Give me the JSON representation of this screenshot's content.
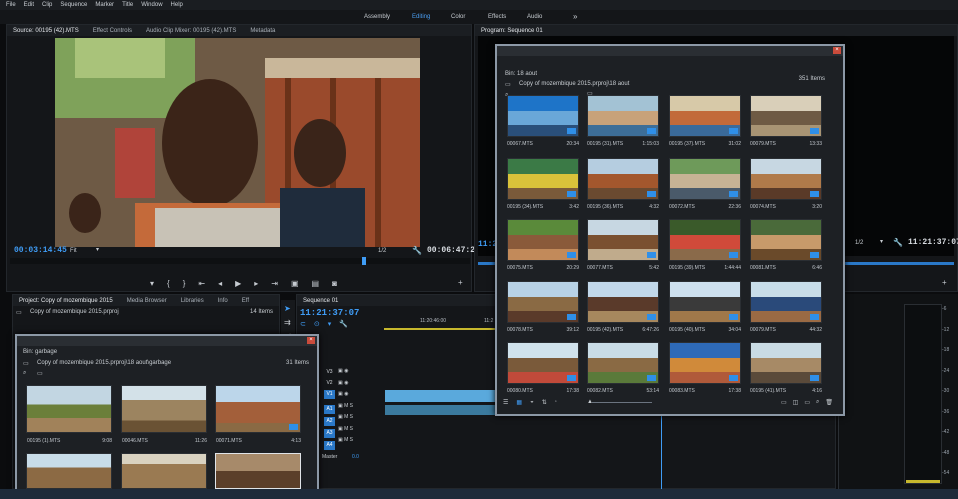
{
  "menu": [
    "File",
    "Edit",
    "Clip",
    "Sequence",
    "Marker",
    "Title",
    "Window",
    "Help"
  ],
  "workspaces": [
    "Assembly",
    "Editing",
    "Color",
    "Effects",
    "Audio"
  ],
  "workspace_more": "»",
  "source_tabs": [
    "Source: 00195 (42).MTS",
    "Effect Controls",
    "Audio Clip Mixer: 00195 (42).MTS",
    "Metadata"
  ],
  "source_monitor": {
    "timecode_in": "00:03:14:45",
    "fit": "Fit",
    "resolution": "1/2",
    "timecode_out": "00:06:47:26"
  },
  "program_monitor": {
    "tab": "Program: Sequence 01",
    "timecode_left": "11:21",
    "resolution": "1/2",
    "timecode_right": "11:21:37:07"
  },
  "project_tabs": [
    "Project: Copy of mozembique 2015",
    "Media Browser",
    "Libraries",
    "Info",
    "Eff"
  ],
  "project": {
    "path": "Copy of mozembique 2015.prproj",
    "count": "14 Items"
  },
  "garbage_bin": {
    "title": "Bin: garbage",
    "path": "Copy of mozembique 2015.prproj\\18 aout\\garbage",
    "count": "31 Items",
    "clips": [
      {
        "name": "00195 (1).MTS",
        "duration": "9:08"
      },
      {
        "name": "00046.MTS",
        "duration": "11:26"
      },
      {
        "name": "00071.MTS",
        "duration": "4:13"
      },
      {
        "name": "",
        "duration": ""
      },
      {
        "name": "",
        "duration": ""
      },
      {
        "name": "",
        "duration": ""
      }
    ]
  },
  "sequence": {
    "tab": "Sequence 01",
    "timecode": "11:21:37:07",
    "ruler_left": "11:20:46:00",
    "ruler_right": "11:2",
    "tracks": [
      "V3",
      "V2",
      "V1",
      "A1",
      "A2",
      "A3",
      "A4"
    ],
    "master_label": "Master",
    "master_value": "0.0"
  },
  "aout_bin": {
    "title": "Bin: 18 aout",
    "path": "Copy of mozembique 2015.prproj\\18 aout",
    "count": "351 Items",
    "clips": [
      {
        "name": "00067.MTS",
        "duration": "20:34"
      },
      {
        "name": "00195 (31).MTS",
        "duration": "1:15:03"
      },
      {
        "name": "00195 (37).MTS",
        "duration": "31:02"
      },
      {
        "name": "00079.MTS",
        "duration": "13:33"
      },
      {
        "name": "00195 (34).MTS",
        "duration": "3:42"
      },
      {
        "name": "00195 (36).MTS",
        "duration": "4:32"
      },
      {
        "name": "00072.MTS",
        "duration": "22:36"
      },
      {
        "name": "00074.MTS",
        "duration": "3:20"
      },
      {
        "name": "00075.MTS",
        "duration": "20:29"
      },
      {
        "name": "00077.MTS",
        "duration": "5:42"
      },
      {
        "name": "00195 (39).MTS",
        "duration": "1:44:44"
      },
      {
        "name": "00081.MTS",
        "duration": "6:46"
      },
      {
        "name": "00078.MTS",
        "duration": "39:12"
      },
      {
        "name": "00195 (42).MTS",
        "duration": "6:47:26"
      },
      {
        "name": "00195 (40).MTS",
        "duration": "34:04"
      },
      {
        "name": "00079.MTS",
        "duration": "44:32"
      },
      {
        "name": "00080.MTS",
        "duration": "17:38"
      },
      {
        "name": "00082.MTS",
        "duration": "53:14"
      },
      {
        "name": "00083.MTS",
        "duration": "17:38"
      },
      {
        "name": "00195 (41).MTS",
        "duration": "4:16"
      }
    ]
  },
  "meter_labels": [
    "-6",
    "-12",
    "-18",
    "-24",
    "-30",
    "-36",
    "-42",
    "-48",
    "-54"
  ]
}
